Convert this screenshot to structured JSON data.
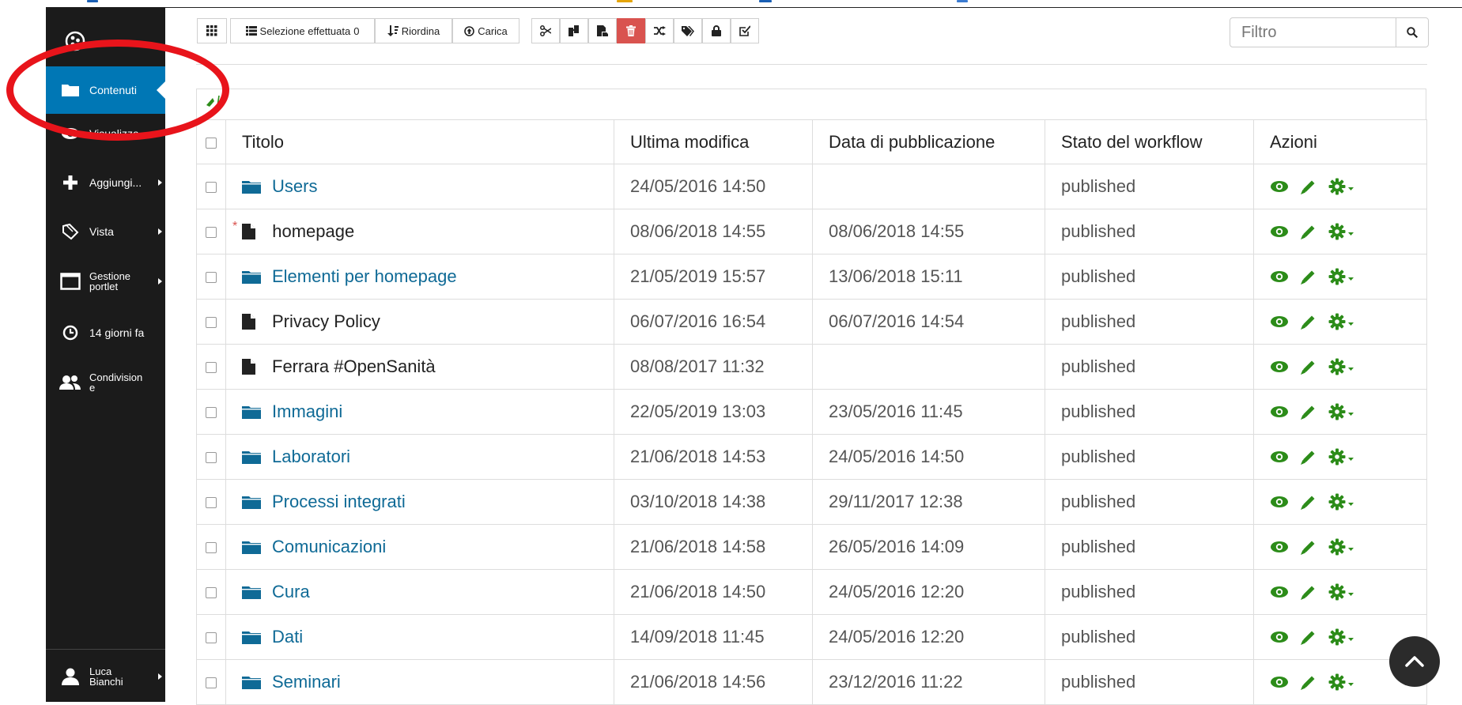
{
  "colors": {
    "sidebar_bg": "#1b1b1b",
    "accent_blue": "#0077b5",
    "link": "#0f6a96",
    "action_green": "#2c8c19",
    "delete_red": "#d9534f",
    "annotation_red": "#e8141b"
  },
  "sidebar": {
    "items": [
      {
        "label": "Contenuti",
        "icon": "folder-open-icon",
        "active": true
      },
      {
        "label": "Visualizza",
        "icon": "eye-icon"
      },
      {
        "label": "Aggiungi...",
        "icon": "plus-icon"
      },
      {
        "label": "Vista",
        "icon": "tags-icon"
      },
      {
        "label": "Gestione portlet",
        "icon": "window-icon"
      },
      {
        "label": "14 giorni fa",
        "icon": "clock-icon"
      },
      {
        "label": "Condivisione",
        "icon": "users-icon"
      }
    ],
    "user": {
      "name": "Luca Bianchi",
      "icon": "user-icon"
    }
  },
  "toolbar": {
    "selection_label": "Selezione effettuata",
    "selection_count": "0",
    "reorder_label": "Riordina",
    "upload_label": "Carica",
    "actions": [
      "cut-icon",
      "copy-icon",
      "paste-icon",
      "delete-icon",
      "rename-icon",
      "tags-icon",
      "lock-icon",
      "workflow-icon"
    ],
    "filter_placeholder": "Filtro"
  },
  "table": {
    "headers": {
      "title": "Titolo",
      "modified": "Ultima modifica",
      "published": "Data di pubblicazione",
      "state": "Stato del workflow",
      "actions": "Azioni"
    },
    "rows": [
      {
        "title": "Users",
        "type": "folder",
        "modified": "24/05/2016 14:50",
        "published": "",
        "state": "published"
      },
      {
        "title": "homepage",
        "type": "page",
        "marked": "*",
        "modified": "08/06/2018 14:55",
        "published": "08/06/2018 14:55",
        "state": "published"
      },
      {
        "title": "Elementi per homepage",
        "type": "folder",
        "modified": "21/05/2019 15:57",
        "published": "13/06/2018 15:11",
        "state": "published"
      },
      {
        "title": "Privacy Policy",
        "type": "page",
        "modified": "06/07/2016 16:54",
        "published": "06/07/2016 14:54",
        "state": "published"
      },
      {
        "title": "Ferrara #OpenSanità",
        "type": "page",
        "modified": "08/08/2017 11:32",
        "published": "",
        "state": "published"
      },
      {
        "title": "Immagini",
        "type": "folder",
        "modified": "22/05/2019 13:03",
        "published": "23/05/2016 11:45",
        "state": "published"
      },
      {
        "title": "Laboratori",
        "type": "folder",
        "modified": "21/06/2018 14:53",
        "published": "24/05/2016 14:50",
        "state": "published"
      },
      {
        "title": "Processi integrati",
        "type": "folder",
        "modified": "03/10/2018 14:38",
        "published": "29/11/2017 12:38",
        "state": "published"
      },
      {
        "title": "Comunicazioni",
        "type": "folder",
        "modified": "21/06/2018 14:58",
        "published": "26/05/2016 14:09",
        "state": "published"
      },
      {
        "title": "Cura",
        "type": "folder",
        "modified": "21/06/2018 14:50",
        "published": "24/05/2016 12:20",
        "state": "published"
      },
      {
        "title": "Dati",
        "type": "folder",
        "modified": "14/09/2018 11:45",
        "published": "24/05/2016 12:20",
        "state": "published"
      },
      {
        "title": "Seminari",
        "type": "folder",
        "modified": "21/06/2018 14:56",
        "published": "23/12/2016 11:22",
        "state": "published"
      }
    ]
  }
}
